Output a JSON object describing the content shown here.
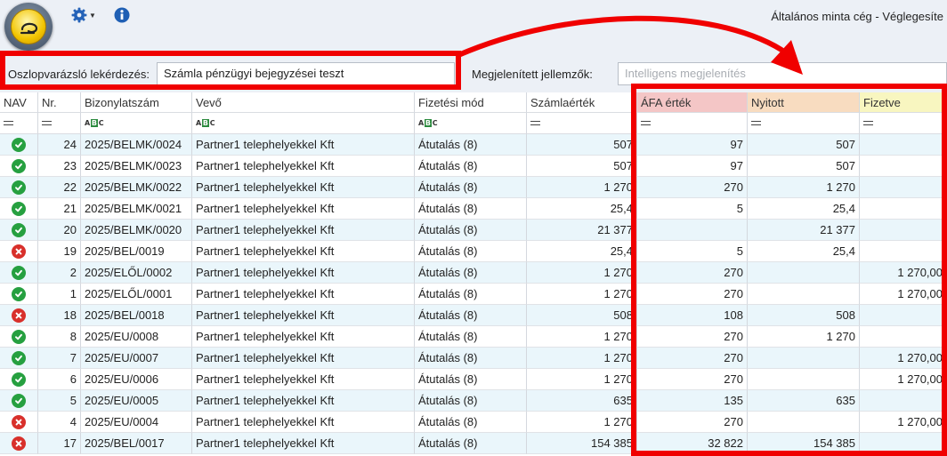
{
  "header": {
    "window_title": "Általános minta cég - Véglegesíte",
    "app_icon": "app-logo-icon",
    "settings_icon": "gear-icon",
    "settings_dropdown_icon": "caret-down-icon",
    "info_icon": "info-icon"
  },
  "filter": {
    "query_label": "Oszlopvarázsló lekérdezés:",
    "query_value": "Számla pénzügyi bejegyzései teszt",
    "props_label": "Megjelenített jellemzők:",
    "props_placeholder": "Intelligens megjelenítés"
  },
  "colors": {
    "highlight": "#f00000",
    "afa_header": "#f4c6c6",
    "nyitott_header": "#f8dcc0",
    "fizetve_header": "#f8f6c0",
    "status_ok": "#26a040",
    "status_error": "#d8302b"
  },
  "table": {
    "columns": [
      "NAV",
      "Nr.",
      "Bizonylatszám",
      "Vevő",
      "Fizetési mód",
      "Számlaérték",
      "ÁFA érték",
      "Nyitott",
      "Fizetve"
    ],
    "filter_types": [
      "equals",
      "equals",
      "text",
      "text",
      "text",
      "equals",
      "equals",
      "equals",
      "equals"
    ],
    "rows": [
      {
        "nav": "ok",
        "nr": "24",
        "doc": "2025/BELMK/0024",
        "customer": "Partner1 telephelyekkel Kft",
        "payment": "Átutalás (8)",
        "value": "507",
        "vat": "97",
        "open": "507",
        "paid": ""
      },
      {
        "nav": "ok",
        "nr": "23",
        "doc": "2025/BELMK/0023",
        "customer": "Partner1 telephelyekkel Kft",
        "payment": "Átutalás (8)",
        "value": "507",
        "vat": "97",
        "open": "507",
        "paid": ""
      },
      {
        "nav": "ok",
        "nr": "22",
        "doc": "2025/BELMK/0022",
        "customer": "Partner1 telephelyekkel Kft",
        "payment": "Átutalás (8)",
        "value": "1 270",
        "vat": "270",
        "open": "1 270",
        "paid": ""
      },
      {
        "nav": "ok",
        "nr": "21",
        "doc": "2025/BELMK/0021",
        "customer": "Partner1 telephelyekkel Kft",
        "payment": "Átutalás (8)",
        "value": "25,4",
        "vat": "5",
        "open": "25,4",
        "paid": ""
      },
      {
        "nav": "ok",
        "nr": "20",
        "doc": "2025/BELMK/0020",
        "customer": "Partner1 telephelyekkel Kft",
        "payment": "Átutalás (8)",
        "value": "21 377",
        "vat": "",
        "open": "21 377",
        "paid": ""
      },
      {
        "nav": "error",
        "nr": "19",
        "doc": "2025/BEL/0019",
        "customer": "Partner1 telephelyekkel Kft",
        "payment": "Átutalás (8)",
        "value": "25,4",
        "vat": "5",
        "open": "25,4",
        "paid": ""
      },
      {
        "nav": "ok",
        "nr": "2",
        "doc": "2025/ELŐL/0002",
        "customer": "Partner1 telephelyekkel Kft",
        "payment": "Átutalás (8)",
        "value": "1 270",
        "vat": "270",
        "open": "",
        "paid": "1 270,00"
      },
      {
        "nav": "ok",
        "nr": "1",
        "doc": "2025/ELŐL/0001",
        "customer": "Partner1 telephelyekkel Kft",
        "payment": "Átutalás (8)",
        "value": "1 270",
        "vat": "270",
        "open": "",
        "paid": "1 270,00"
      },
      {
        "nav": "error",
        "nr": "18",
        "doc": "2025/BEL/0018",
        "customer": "Partner1 telephelyekkel Kft",
        "payment": "Átutalás (8)",
        "value": "508",
        "vat": "108",
        "open": "508",
        "paid": ""
      },
      {
        "nav": "ok",
        "nr": "8",
        "doc": "2025/EU/0008",
        "customer": "Partner1 telephelyekkel Kft",
        "payment": "Átutalás (8)",
        "value": "1 270",
        "vat": "270",
        "open": "1 270",
        "paid": ""
      },
      {
        "nav": "ok",
        "nr": "7",
        "doc": "2025/EU/0007",
        "customer": "Partner1 telephelyekkel Kft",
        "payment": "Átutalás (8)",
        "value": "1 270",
        "vat": "270",
        "open": "",
        "paid": "1 270,00"
      },
      {
        "nav": "ok",
        "nr": "6",
        "doc": "2025/EU/0006",
        "customer": "Partner1 telephelyekkel Kft",
        "payment": "Átutalás (8)",
        "value": "1 270",
        "vat": "270",
        "open": "",
        "paid": "1 270,00"
      },
      {
        "nav": "ok",
        "nr": "5",
        "doc": "2025/EU/0005",
        "customer": "Partner1 telephelyekkel Kft",
        "payment": "Átutalás (8)",
        "value": "635",
        "vat": "135",
        "open": "635",
        "paid": ""
      },
      {
        "nav": "error",
        "nr": "4",
        "doc": "2025/EU/0004",
        "customer": "Partner1 telephelyekkel Kft",
        "payment": "Átutalás (8)",
        "value": "1 270",
        "vat": "270",
        "open": "",
        "paid": "1 270,00"
      },
      {
        "nav": "error",
        "nr": "17",
        "doc": "2025/BEL/0017",
        "customer": "Partner1 telephelyekkel Kft",
        "payment": "Átutalás (8)",
        "value": "154 385",
        "vat": "32 822",
        "open": "154 385",
        "paid": ""
      }
    ]
  }
}
